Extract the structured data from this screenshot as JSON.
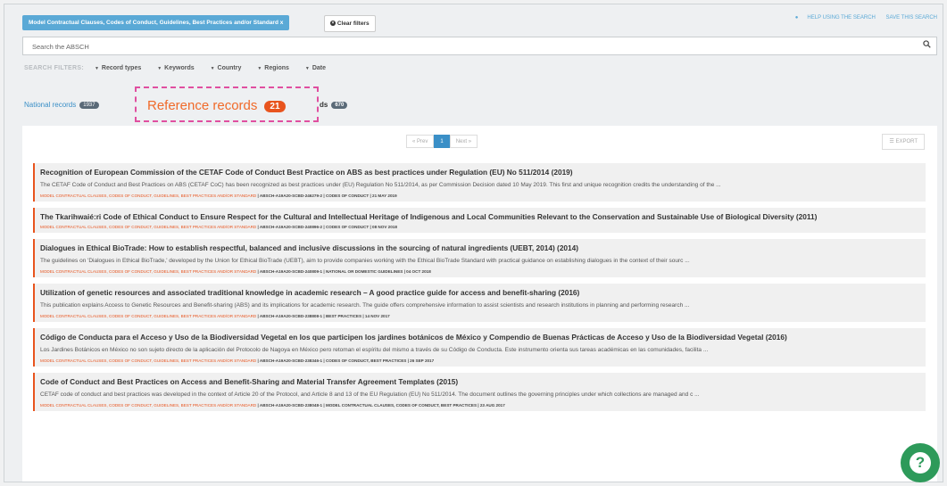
{
  "topbar": {
    "active_filter": "Model Contractual Clauses, Codes of Conduct, Guidelines, Best Practices and/or Standard x",
    "clear_filters": "Clear filters",
    "help_link": "HELP USING THE SEARCH",
    "save_link": "SAVE THIS SEARCH"
  },
  "search": {
    "placeholder": "Search the ABSCH"
  },
  "filters": {
    "label": "SEARCH FILTERS:",
    "items": [
      "Record types",
      "Keywords",
      "Country",
      "Regions",
      "Date"
    ]
  },
  "tabs": {
    "national": {
      "label": "National records",
      "count": "1937"
    },
    "reference": {
      "label": "Reference records",
      "count": "21"
    },
    "other": {
      "label": "ds",
      "count": "670"
    }
  },
  "pager": {
    "prev": "« Prev",
    "current": "1",
    "next": "Next »"
  },
  "export_label": "EXPORT",
  "records": [
    {
      "title": "Recognition of European Commission of the CETAF Code of Conduct Best Practice on ABS as best practices under Regulation (EU) No 511/2014 (2019)",
      "description": "The CETAF Code of Conduct and Best Practices on ABS (CETAF CoC) has been recognized as best practices under (EU) Regulation No 511/2014, as per Commission Decision dated 10 May 2019. This first and unique recognition credits the understanding of the ...",
      "category": "MODEL CONTRACTUAL CLAUSES, CODES OF CONDUCT, GUIDELINES, BEST PRACTICES AND/OR STANDARD",
      "id": "ABSCH-A19A20-SCBD-246279-2",
      "type": "CODES OF CONDUCT",
      "date": "21 MAY 2019"
    },
    {
      "title": "The Tkarihwaié:ri Code of Ethical Conduct to Ensure Respect for the Cultural and Intellectual Heritage of Indigenous and Local Communities Relevant to the Conservation and Sustainable Use of Biological Diversity (2011)",
      "description": "",
      "category": "MODEL CONTRACTUAL CLAUSES, CODES OF CONDUCT, GUIDELINES, BEST PRACTICES AND/OR STANDARD",
      "id": "ABSCH-A19A20-SCBD-240896-2",
      "type": "CODES OF CONDUCT",
      "date": "08 NOV 2018"
    },
    {
      "title": "Dialogues in Ethical BioTrade: How to establish respectful, balanced and inclusive discussions in the sourcing of natural ingredients (UEBT, 2014) (2014)",
      "description": "The guidelines on 'Dialogues in Ethical BioTrade,' developed by the Union for Ethical BioTrade (UEBT), aim to provide companies working with the Ethical BioTrade Standard with practical guidance on establishing dialogues in the context of their sourc ...",
      "category": "MODEL CONTRACTUAL CLAUSES, CODES OF CONDUCT, GUIDELINES, BEST PRACTICES AND/OR STANDARD",
      "id": "ABSCH-A19A20-SCBD-240809-1",
      "type": "NATIONAL OR DOMESTIC GUIDELINES",
      "date": "04 OCT 2018"
    },
    {
      "title": "Utilization of genetic resources and associated traditional knowledge in academic research – A good practice guide for access and benefit-sharing (2016)",
      "description": "This publication explains Access to Genetic Resources and Benefit-sharing (ABS) and its implications for academic research. The guide offers comprehensive information to assist scientists and research institutions in planning and performing research ...",
      "category": "MODEL CONTRACTUAL CLAUSES, CODES OF CONDUCT, GUIDELINES, BEST PRACTICES AND/OR STANDARD",
      "id": "ABSCH-A19A20-SCBD-238808-1",
      "type": "BEST PRACTICES",
      "date": "14 NOV 2017"
    },
    {
      "title": "Código de Conducta para el Acceso y Uso de la Biodiversidad Vegetal en los que participen los jardines botánicos de México y Compendio de Buenas Prácticas de Acceso y Uso de la Biodiversidad Vegetal (2016)",
      "description": "Los Jardines Botánicos en México no son sujeto directo de la aplicación del Protocolo de Nagoya en México pero retoman el espíritu del mismo a través de su Código de Conducta. Este instrumento orienta sus tareas académicas en las comunidades, facilita ...",
      "category": "MODEL CONTRACTUAL CLAUSES, CODES OF CONDUCT, GUIDELINES, BEST PRACTICES AND/OR STANDARD",
      "id": "ABSCH-A19A20-SCBD-238346-1",
      "type": "CODES OF CONDUCT, BEST PRACTICES",
      "date": "26 SEP 2017"
    },
    {
      "title": "Code of Conduct and Best Practices on Access and Benefit-Sharing and Material Transfer Agreement Templates (2015)",
      "description": "CETAF code of conduct and best practices was developed in the context of Article 20 of the Protocol, and Article 8 and 13 of the EU Regulation (EU) No 511/2014. The document outlines the governing principles under which collections are managed and c ...",
      "category": "MODEL CONTRACTUAL CLAUSES, CODES OF CONDUCT, GUIDELINES, BEST PRACTICES AND/OR STANDARD",
      "id": "ABSCH-A19A20-SCBD-238048-1",
      "type": "MODEL CONTRACTUAL CLAUSES, CODES OF CONDUCT, BEST PRACTICES",
      "date": "23 AUG 2017"
    }
  ],
  "colors": {
    "accent": "#e8541e",
    "link": "#3a8fc7",
    "highlight_border": "#e04fa0",
    "help_fab": "#2d9a5a"
  },
  "icons": {
    "search": "magnifier",
    "clear": "times-circle",
    "help": "question-mark",
    "export": "list"
  }
}
